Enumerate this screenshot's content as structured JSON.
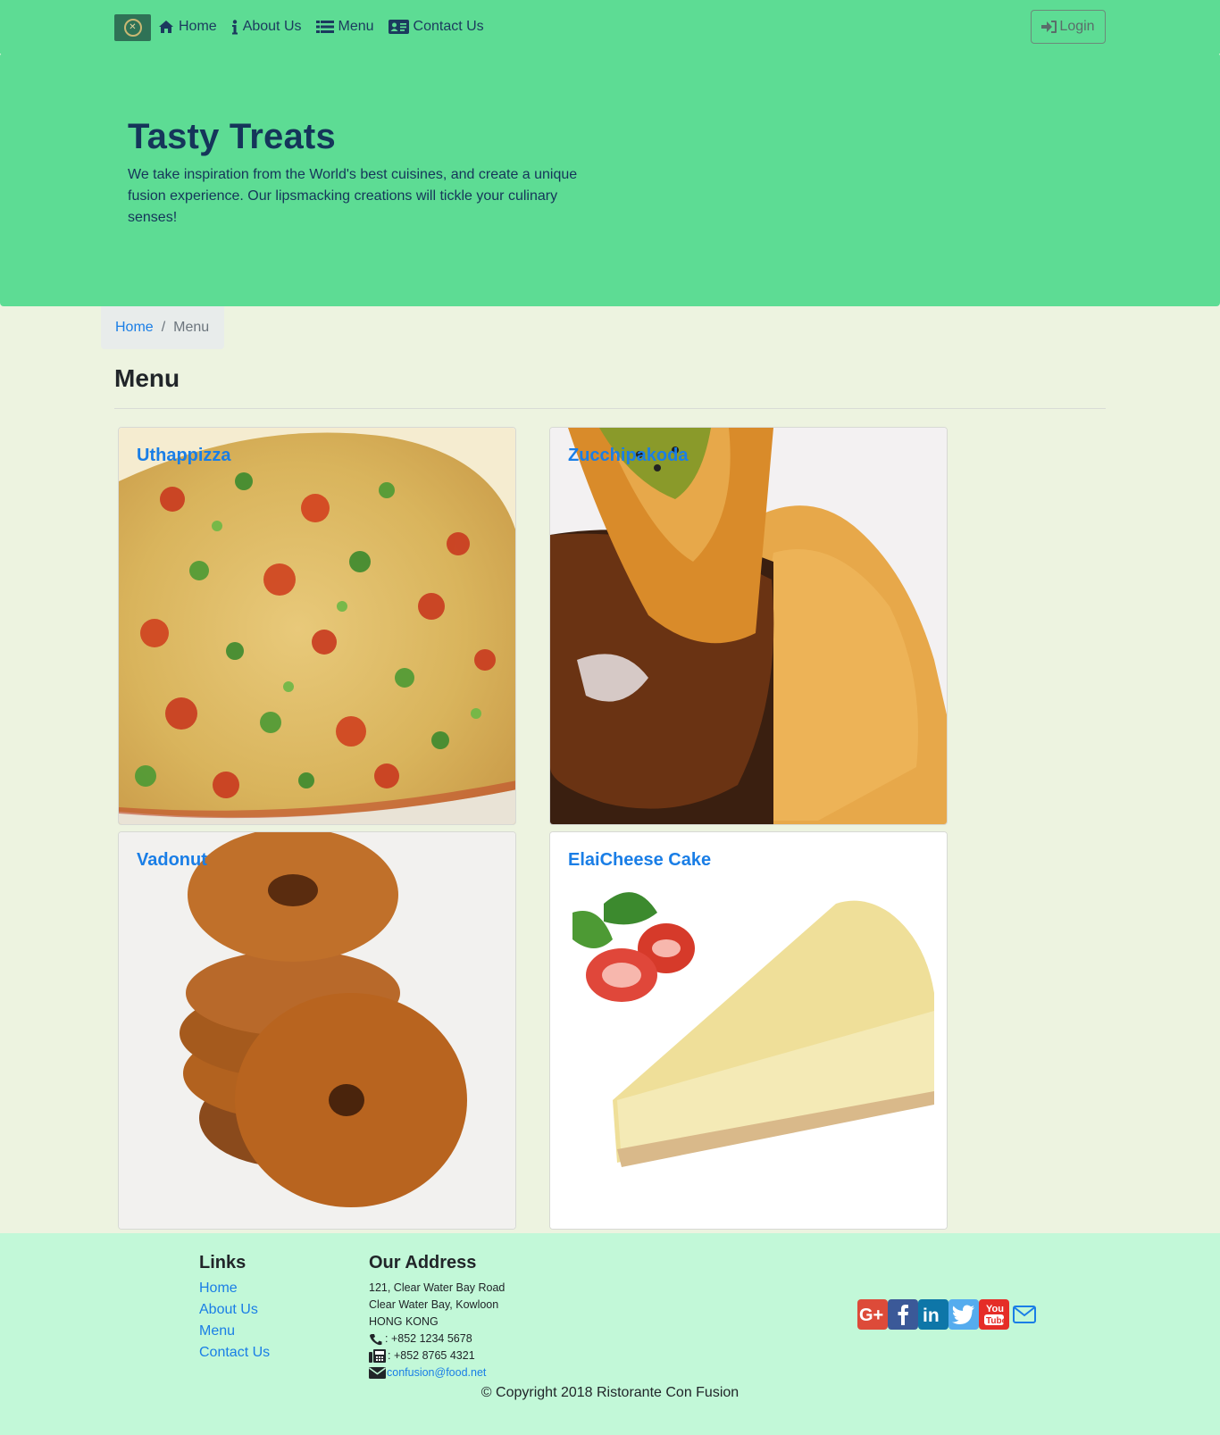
{
  "nav": {
    "brand_logo_icon": "restaurant-logo-icon",
    "items": [
      {
        "label": "Home",
        "icon": "home-icon"
      },
      {
        "label": "About Us",
        "icon": "info-icon"
      },
      {
        "label": "Menu",
        "icon": "list-icon"
      },
      {
        "label": "Contact Us",
        "icon": "address-card-icon"
      }
    ],
    "login_label": "Login",
    "login_icon": "sign-in-icon"
  },
  "jumbotron": {
    "title": "Tasty Treats",
    "text": "We take inspiration from the World's best cuisines, and create a unique fusion experience. Our lipsmacking creations will tickle your culinary senses!"
  },
  "breadcrumb": {
    "home": "Home",
    "separator": "/",
    "active": "Menu"
  },
  "page_title": "Menu",
  "dishes": [
    {
      "name": "Uthappizza"
    },
    {
      "name": "Zucchipakoda"
    },
    {
      "name": "Vadonut"
    },
    {
      "name": "ElaiCheese Cake"
    }
  ],
  "footer": {
    "links_heading": "Links",
    "links": [
      "Home",
      "About Us",
      "Menu",
      "Contact Us"
    ],
    "address_heading": "Our Address",
    "address_lines": [
      "121, Clear Water Bay Road",
      "Clear Water Bay, Kowloon",
      "HONG KONG"
    ],
    "phone": ": +852 1234 5678",
    "fax": ": +852 8765 4321",
    "email": "confusion@food.net",
    "social": [
      {
        "icon": "google-plus-icon",
        "color": "#dd4b39"
      },
      {
        "icon": "facebook-icon",
        "color": "#3b5998"
      },
      {
        "icon": "linkedin-icon",
        "color": "#0e76a8"
      },
      {
        "icon": "twitter-icon",
        "color": "#55acee"
      },
      {
        "icon": "youtube-icon",
        "color": "#e52d27"
      },
      {
        "icon": "envelope-icon",
        "color": "#1a7ee6"
      }
    ],
    "copyright": "© Copyright 2018 Ristorante Con Fusion"
  },
  "colors": {
    "navbar": "#5ddc94",
    "page_bg": "#edf3e0",
    "footer_bg": "#c2f8d8",
    "link": "#1a7ee6",
    "heading_dark": "#15355a"
  }
}
